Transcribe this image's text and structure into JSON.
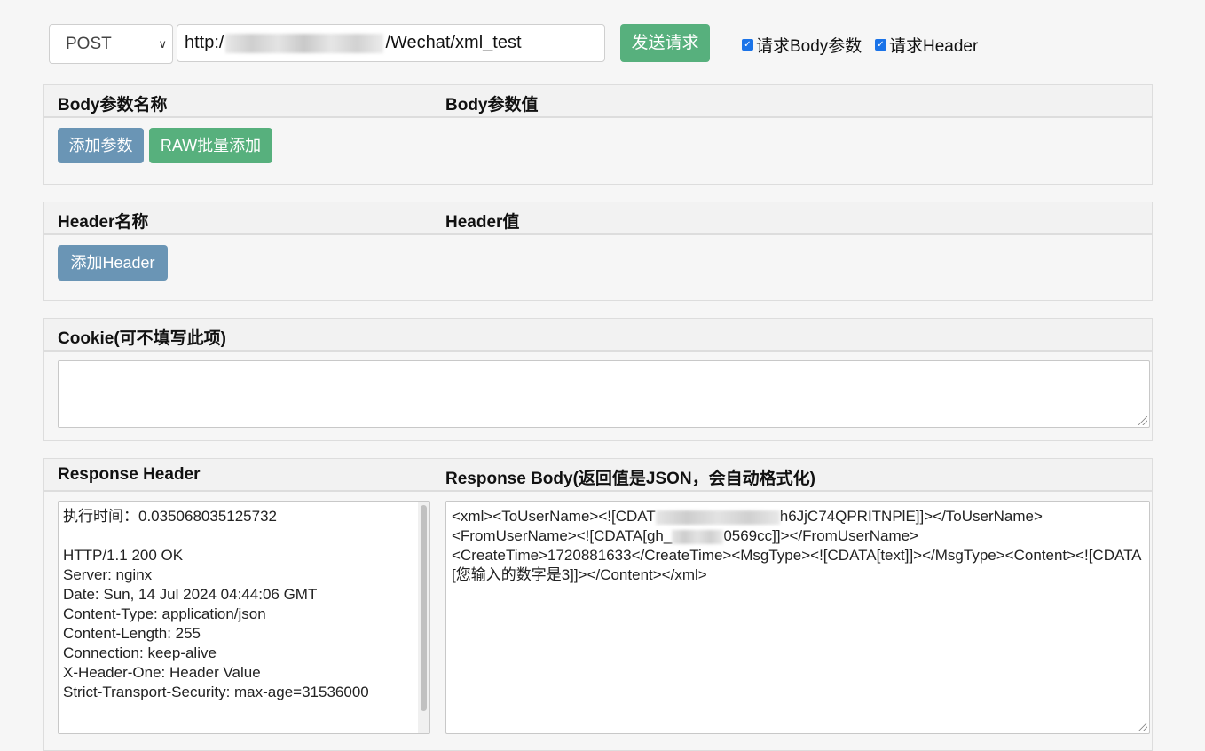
{
  "request": {
    "method": "POST",
    "url_prefix": "http:/",
    "url_suffix": "/Wechat/xml_test",
    "send_label": "发送请求",
    "checkbox_body_label": "请求Body参数",
    "checkbox_header_label": "请求Header",
    "checkbox_body_checked": true,
    "checkbox_header_checked": true
  },
  "body_panel": {
    "col_name": "Body参数名称",
    "col_value": "Body参数值",
    "add_label": "添加参数",
    "raw_label": "RAW批量添加"
  },
  "header_panel": {
    "col_name": "Header名称",
    "col_value": "Header值",
    "add_label": "添加Header"
  },
  "cookie_panel": {
    "title": "Cookie(可不填写此项)",
    "value": ""
  },
  "response_panel": {
    "header_title": "Response Header",
    "body_title": "Response Body(返回值是JSON，会自动格式化)",
    "header_text": "执行时间：0.035068035125732\n\nHTTP/1.1 200 OK\nServer: nginx\nDate: Sun, 14 Jul 2024 04:44:06 GMT\nContent-Type: application/json\nContent-Length: 255\nConnection: keep-alive\nX-Header-One: Header Value\nStrict-Transport-Security: max-age=31536000",
    "body_line1_a": "<xml><ToUserName><![CDAT",
    "body_line1_b": "h6JjC74QPRITNPlE]]></ToUserName>",
    "body_line2_a": "<FromUserName><![CDATA[gh_",
    "body_line2_b": "0569cc]]></FromUserName>",
    "body_rest": "<CreateTime>1720881633</CreateTime><MsgType><![CDATA[text]]></MsgType><Content><![CDATA[您输入的数字是3]]></Content></xml>"
  },
  "colors": {
    "green": "#57b07d",
    "blue": "#6a95b5",
    "checkbox": "#1a73e8"
  }
}
